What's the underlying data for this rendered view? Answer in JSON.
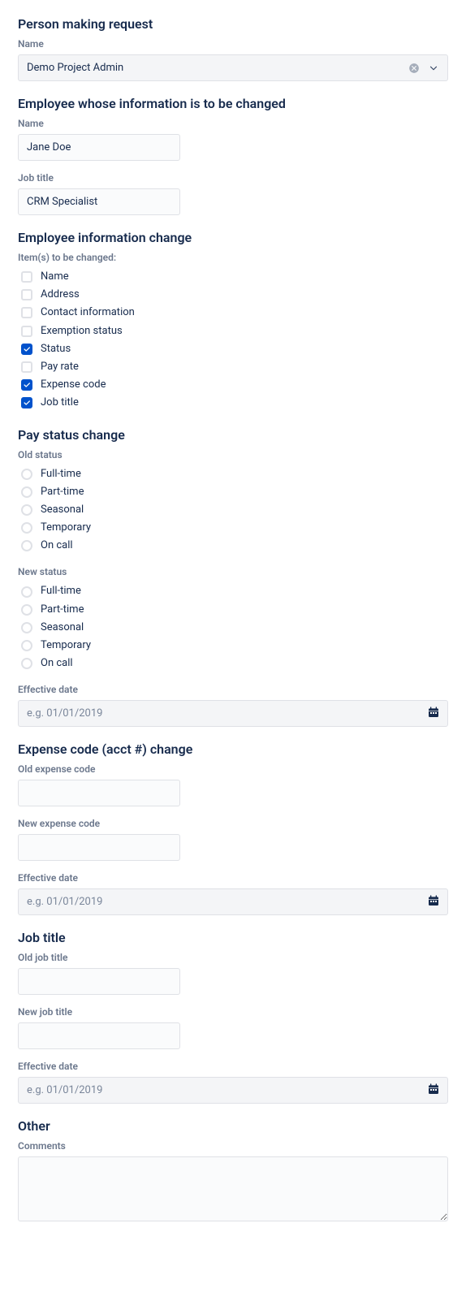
{
  "requester": {
    "section_title": "Person making request",
    "name_label": "Name",
    "name_value": "Demo Project Admin"
  },
  "employee": {
    "section_title": "Employee whose information is to be changed",
    "name_label": "Name",
    "name_value": "Jane Doe",
    "jobtitle_label": "Job title",
    "jobtitle_value": "CRM Specialist"
  },
  "change": {
    "section_title": "Employee information change",
    "items_label": "Item(s) to be changed:",
    "items": [
      {
        "label": "Name",
        "checked": false
      },
      {
        "label": "Address",
        "checked": false
      },
      {
        "label": "Contact information",
        "checked": false
      },
      {
        "label": "Exemption status",
        "checked": false
      },
      {
        "label": "Status",
        "checked": true
      },
      {
        "label": "Pay rate",
        "checked": false
      },
      {
        "label": "Expense code",
        "checked": true
      },
      {
        "label": "Job title",
        "checked": true
      }
    ]
  },
  "pay_status": {
    "section_title": "Pay status change",
    "old_label": "Old status",
    "new_label": "New status",
    "options": [
      "Full-time",
      "Part-time",
      "Seasonal",
      "Temporary",
      "On call"
    ],
    "effective_label": "Effective date",
    "effective_placeholder": "e.g. 01/01/2019"
  },
  "expense": {
    "section_title": "Expense code (acct #) change",
    "old_label": "Old expense code",
    "new_label": "New expense code",
    "effective_label": "Effective date",
    "effective_placeholder": "e.g. 01/01/2019"
  },
  "job_title": {
    "section_title": "Job title",
    "old_label": "Old job title",
    "new_label": "New job title",
    "effective_label": "Effective date",
    "effective_placeholder": "e.g. 01/01/2019"
  },
  "other": {
    "section_title": "Other",
    "comments_label": "Comments"
  }
}
